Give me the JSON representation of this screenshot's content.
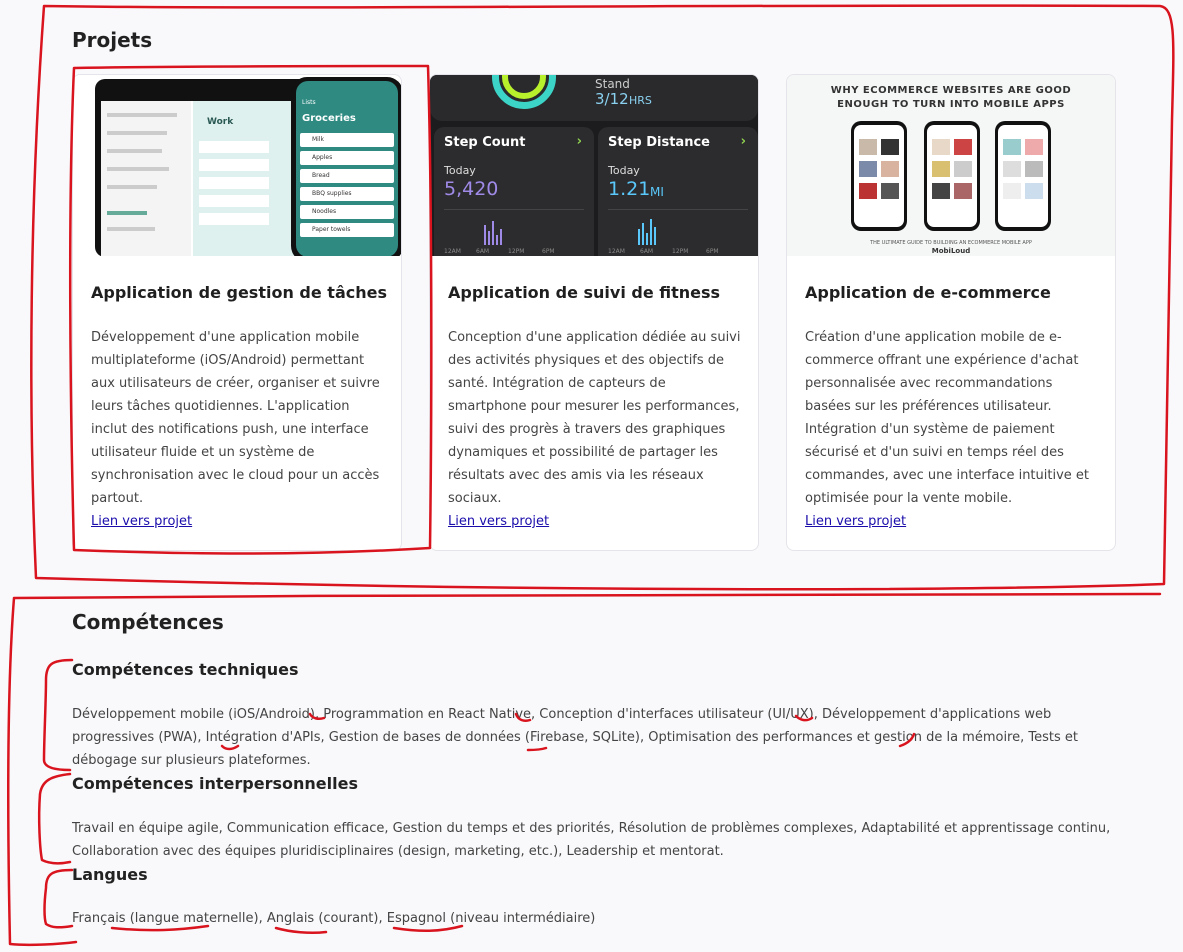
{
  "projets": {
    "title": "Projets",
    "cards": [
      {
        "title": "Application de gestion de tâches",
        "description": "Développement d'une application mobile multiplateforme (iOS/Android) permettant aux utilisateurs de créer, organiser et suivre leurs tâches quotidiennes. L'application inclut des notifications push, une interface utilisateur fluide et un système de synchronisation avec le cloud pour un accès partout.",
        "link": "Lien vers projet",
        "image": {
          "work_label": "Work",
          "groceries_label": "Groceries",
          "back_label": "Lists",
          "items": [
            "Milk",
            "Apples",
            "Bread",
            "BBQ supplies",
            "Noodles",
            "Paper towels"
          ]
        }
      },
      {
        "title": "Application de suivi de fitness",
        "description": "Conception d'une application dédiée au suivi des activités physiques et des objectifs de santé. Intégration de capteurs de smartphone pour mesurer les performances, suivi des progrès à travers des graphiques dynamiques et possibilité de partager les résultats avec des amis via les réseaux sociaux.",
        "link": "Lien vers projet",
        "image": {
          "stand_label": "Stand",
          "stand_value": "3/12",
          "stand_unit": "HRS",
          "panels": [
            {
              "label": "Step Count",
              "today": "Today",
              "value": "5,420",
              "unit": ""
            },
            {
              "label": "Step Distance",
              "today": "Today",
              "value": "1.21",
              "unit": "MI"
            }
          ],
          "axis": [
            "12AM",
            "6AM",
            "12PM",
            "6PM"
          ]
        }
      },
      {
        "title": "Application de e-commerce",
        "description": "Création d'une application mobile de e-commerce offrant une expérience d'achat personnalisée avec recommandations basées sur les préférences utilisateur. Intégration d'un système de paiement sécurisé et d'un suivi en temps réel des commandes, avec une interface intuitive et optimisée pour la vente mobile.",
        "link": "Lien vers projet",
        "image": {
          "headline_1": "WHY ECOMMERCE WEBSITES ARE GOOD",
          "headline_2": "ENOUGH TO TURN INTO MOBILE APPS",
          "footer": "THE ULTIMATE GUIDE TO BUILDING AN ECOMMERCE MOBILE APP",
          "brand": "MobiLoud"
        }
      }
    ]
  },
  "competences": {
    "title": "Compétences",
    "techniques": {
      "title": "Compétences techniques",
      "text": "Développement mobile (iOS/Android), Programmation en React Native, Conception d'interfaces utilisateur (UI/UX), Développement d'applications web progressives (PWA), Intégration d'APIs, Gestion de bases de données (Firebase, SQLite), Optimisation des performances et gestion de la mémoire, Tests et débogage sur plusieurs plateformes."
    },
    "interpersonnelles": {
      "title": "Compétences interpersonnelles",
      "text": "Travail en équipe agile, Communication efficace, Gestion du temps et des priorités, Résolution de problèmes complexes, Adaptabilité et apprentissage continu, Collaboration avec des équipes pluridisciplinaires (design, marketing, etc.), Leadership et mentorat."
    },
    "langues": {
      "title": "Langues",
      "text": "Français (langue maternelle), Anglais (courant), Espagnol (niveau intermédiaire)"
    }
  },
  "colors": {
    "annotation": "#d9141e",
    "link": "#1a0dab",
    "fitness_purple": "#a08ae8",
    "fitness_cyan": "#5ac8fa",
    "task_teal": "#2f8a82"
  }
}
